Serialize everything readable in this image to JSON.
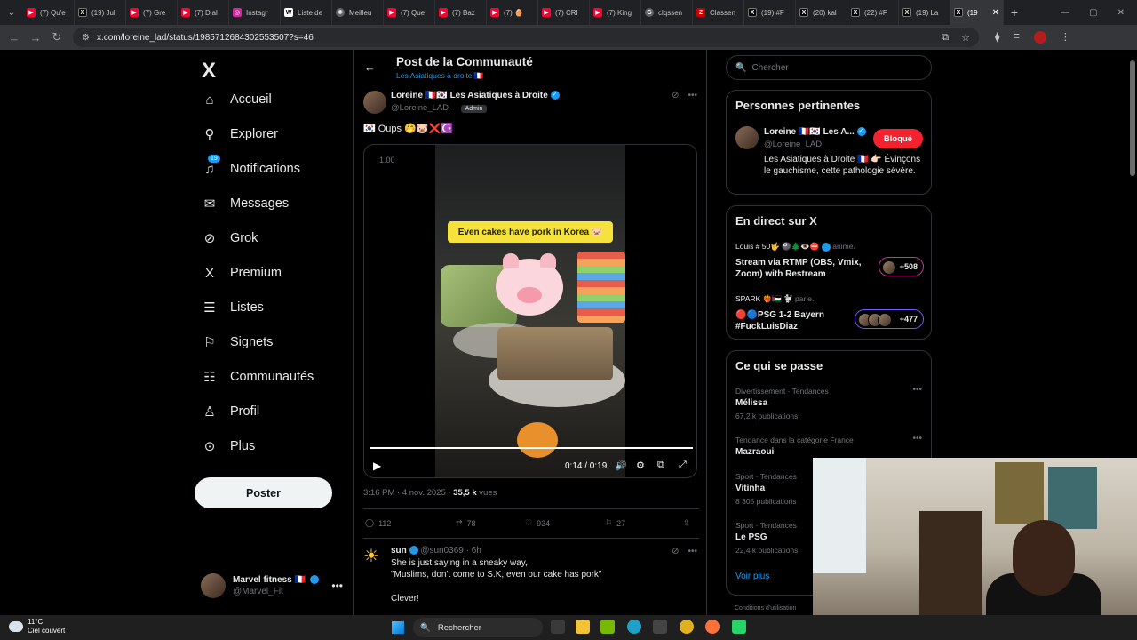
{
  "browser": {
    "tabs": [
      {
        "title": "(7) Qu'e",
        "icon": "youtube"
      },
      {
        "title": "(19) Jul",
        "icon": "x"
      },
      {
        "title": "(7) Gre",
        "icon": "youtube"
      },
      {
        "title": "(7) Dial",
        "icon": "youtube"
      },
      {
        "title": "Instagr",
        "icon": "instagram"
      },
      {
        "title": "Liste de",
        "icon": "wikipedia"
      },
      {
        "title": "Meilleu",
        "icon": "openai"
      },
      {
        "title": "(7) Que",
        "icon": "youtube"
      },
      {
        "title": "(7) Baz",
        "icon": "youtube"
      },
      {
        "title": "(7) 🥚",
        "icon": "youtube"
      },
      {
        "title": "(7) CRI",
        "icon": "youtube"
      },
      {
        "title": "(7) King",
        "icon": "youtube"
      },
      {
        "title": "clqssen",
        "icon": "google"
      },
      {
        "title": "Classen",
        "icon": "z"
      },
      {
        "title": "(19) #F",
        "icon": "x"
      },
      {
        "title": "(20) kal",
        "icon": "x"
      },
      {
        "title": "(22) #F",
        "icon": "x"
      },
      {
        "title": "(19) La",
        "icon": "x"
      },
      {
        "title": "(19",
        "icon": "x",
        "active": true
      }
    ],
    "url": "x.com/loreine_lad/status/1985712684302553507?s=46"
  },
  "nav": {
    "logo": "X",
    "items": [
      {
        "label": "Accueil",
        "icon": "home-icon"
      },
      {
        "label": "Explorer",
        "icon": "search-icon"
      },
      {
        "label": "Notifications",
        "icon": "bell-icon",
        "badge": "19"
      },
      {
        "label": "Messages",
        "icon": "mail-icon"
      },
      {
        "label": "Grok",
        "icon": "grok-icon"
      },
      {
        "label": "Premium",
        "icon": "x-premium-icon"
      },
      {
        "label": "Listes",
        "icon": "list-icon"
      },
      {
        "label": "Signets",
        "icon": "bookmark-icon"
      },
      {
        "label": "Communautés",
        "icon": "communities-icon"
      },
      {
        "label": "Profil",
        "icon": "profile-icon"
      },
      {
        "label": "Plus",
        "icon": "more-circle-icon"
      }
    ],
    "post_button": "Poster",
    "account": {
      "name": "Marvel fitness 🇫🇷",
      "handle": "@Marvel_Fit"
    }
  },
  "header": {
    "title": "Post de la Communauté",
    "subtitle": "Les Asiatiques à droite 🇫🇷"
  },
  "tweet": {
    "author": "Loreine 🇫🇷🇰🇷 Les Asiatiques à Droite",
    "handle": "@Loreine_LAD",
    "role": "Admin",
    "text": "🇰🇷 Oups 🤭🐷❌☪️",
    "video": {
      "rate": "1.00",
      "caption": "Even cakes have pork in Korea 🐷",
      "time": "0:14 / 0:19",
      "progress": 0.74
    },
    "time": "3:16 PM · 4 nov. 2025 ·",
    "views": "35,5 k",
    "views_label": "vues",
    "replies": "112",
    "reposts": "78",
    "likes": "934",
    "bookmarks": "27"
  },
  "reply": {
    "name": "sun",
    "handle": "@sun0369 · 6h",
    "lines": [
      "She is just saying in a sneaky way,",
      "\"Muslims, don't come to S.K, even our cake has pork\"",
      "Clever!"
    ]
  },
  "sidebar": {
    "search_placeholder": "Chercher",
    "relevant": {
      "title": "Personnes pertinentes",
      "name": "Loreine 🇫🇷🇰🇷 Les A...",
      "handle": "@Loreine_LAD",
      "button": "Bloqué",
      "bio": "Les Asiatiques à Droite 🇫🇷 👉🏻 Évinçons le gauchisme, cette pathologie sévère."
    },
    "live": {
      "title": "En direct sur X",
      "items": [
        {
          "host": "Louis # 50🤟 🎱🌲👁️⛔",
          "action": "anime.",
          "title": "Stream via RTMP (OBS, Vmix, Zoom) with Restream",
          "count": "+508"
        },
        {
          "host": "SPARK ❤️‍🔥🇵🇸 🐩",
          "action": "parle.",
          "title": "🔴🔵PSG 1-2 Bayern #FuckLuisDiaz",
          "count": "+477"
        }
      ]
    },
    "trends": {
      "title": "Ce qui se passe",
      "items": [
        {
          "category": "Divertissement · Tendances",
          "name": "Mélissa",
          "count": "67,2 k publications"
        },
        {
          "category": "Tendance dans la catégorie France",
          "name": "Mazraoui",
          "count": ""
        },
        {
          "category": "Sport · Tendances",
          "name": "Vitinha",
          "count": "8 305 publications"
        },
        {
          "category": "Sport · Tendances",
          "name": "Le PSG",
          "count": "22,4 k publications"
        }
      ],
      "see_more": "Voir plus"
    },
    "footer": "Conditions d'utilisation"
  },
  "taskbar": {
    "temp": "11°C",
    "weather": "Ciel couvert",
    "search": "Rechercher"
  }
}
